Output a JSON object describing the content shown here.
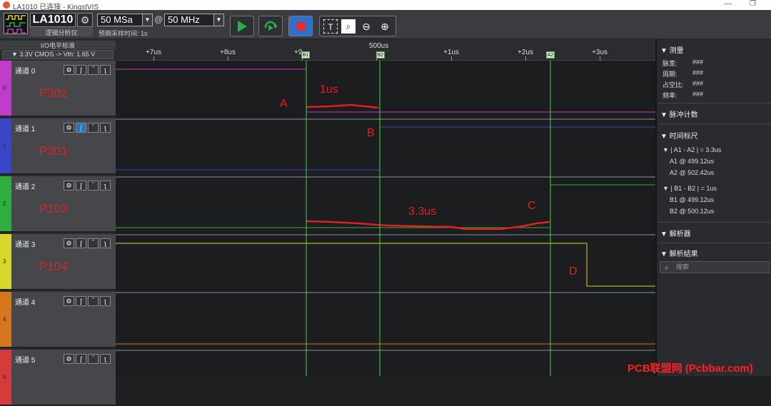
{
  "window": {
    "title": "LA1010 已连接 - KingstVIS",
    "min": "—",
    "restore": "❐"
  },
  "toolbar": {
    "device_name": "LA1010",
    "device_sub": "逻辑分析仪",
    "sample_rate": "50 MSa",
    "at": "@",
    "frequency": "50 MHz",
    "sample_time": "预期采样时间: 1s",
    "colors": {
      "start": "#22b14c",
      "stop": "#e82c2c",
      "stop_bg": "#2f6fce"
    }
  },
  "left": {
    "io_header": "I/O电平标准",
    "io_value": "▼ 3.3V CMOS -> Vth: 1.65 V",
    "channels": [
      {
        "num": "0",
        "name": "通道 0",
        "label": "P302",
        "color": "#c03ccb"
      },
      {
        "num": "1",
        "name": "通道 1",
        "label": "P301",
        "color": "#3a45c8"
      },
      {
        "num": "2",
        "name": "通道 2",
        "label": "P103",
        "color": "#2fae3d"
      },
      {
        "num": "3",
        "name": "通道 3",
        "label": "P104",
        "color": "#d8d82c"
      },
      {
        "num": "4",
        "name": "通道 4",
        "label": "",
        "color": "#d6761e"
      },
      {
        "num": "5",
        "name": "通道 5",
        "label": "",
        "color": "#d63b3b"
      }
    ]
  },
  "ruler": {
    "center": "500us",
    "ticks": [
      "+7us",
      "+8us",
      "+9",
      "+1us",
      "+2us",
      "+3us"
    ],
    "markers": [
      "B1",
      "B2",
      "A2"
    ]
  },
  "annotations": {
    "a": "A",
    "b": "B",
    "c": "C",
    "d": "D",
    "t1": "1us",
    "t2": "3.3us"
  },
  "right": {
    "measure": "▼ 测量",
    "measure_rows": [
      {
        "k": "脉宽:",
        "v": "###"
      },
      {
        "k": "周期:",
        "v": "###"
      },
      {
        "k": "占空比:",
        "v": "###"
      },
      {
        "k": "频率:",
        "v": "###"
      }
    ],
    "pulse_count": "▼ 脉冲计数",
    "time_ruler": "▼ 时间标尺",
    "a_header": "▼ | A1 - A2 | = 3.3us",
    "a1": "A1 @ 499.12us",
    "a2": "A2 @ 502.42us",
    "b_header": "▼ | B1 - B2 | = 1us",
    "b1": "B1 @ 499.12us",
    "b2": "B2 @ 500.12us",
    "analyzer": "▼ 解析器",
    "results": "▼ 解析结果",
    "search_placeholder": "搜索"
  },
  "watermark": "PCB联盟网 (Pcbbar.com)"
}
